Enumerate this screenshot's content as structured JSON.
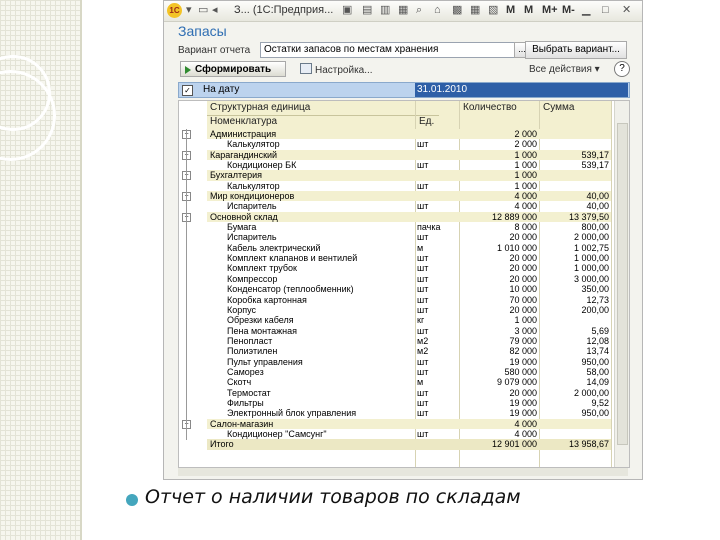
{
  "window": {
    "title": "З... (1С:Предприя...",
    "menu_letters": [
      "M",
      "M",
      "M+",
      "M-"
    ]
  },
  "report_title": "Запасы",
  "variant": {
    "label": "Вариант отчета",
    "value": "Остатки запасов по местам хранения",
    "dots": "...",
    "select_button": "Выбрать вариант..."
  },
  "toolbar": {
    "generate": "Сформировать",
    "settings": "Настройка...",
    "all_actions": "Все действия ▾",
    "help": "?"
  },
  "filter": {
    "label": "На дату",
    "value": "31.01.2010",
    "checked": "✓"
  },
  "table": {
    "headers": {
      "col1_top": "Структурная единица",
      "col1_bottom": "Номенклатура",
      "col2": "Ед.",
      "col3": "Количество",
      "col4": "Сумма"
    },
    "rows": [
      {
        "name": "Администрация",
        "unit": "",
        "qty": "2 000",
        "sum": "",
        "level": 0
      },
      {
        "name": "Калькулятор",
        "unit": "шт",
        "qty": "2 000",
        "sum": "",
        "level": 1
      },
      {
        "name": "Карагандинский",
        "unit": "",
        "qty": "1 000",
        "sum": "539,17",
        "level": 0
      },
      {
        "name": "Кондиционер БК",
        "unit": "шт",
        "qty": "1 000",
        "sum": "539,17",
        "level": 1
      },
      {
        "name": "Бухгалтерия",
        "unit": "",
        "qty": "1 000",
        "sum": "",
        "level": 0
      },
      {
        "name": "Калькулятор",
        "unit": "шт",
        "qty": "1 000",
        "sum": "",
        "level": 1
      },
      {
        "name": "Мир кондиционеров",
        "unit": "",
        "qty": "4 000",
        "sum": "40,00",
        "level": 0
      },
      {
        "name": "Испаритель",
        "unit": "шт",
        "qty": "4 000",
        "sum": "40,00",
        "level": 1
      },
      {
        "name": "Основной склад",
        "unit": "",
        "qty": "12 889 000",
        "sum": "13 379,50",
        "level": 0
      },
      {
        "name": "Бумага",
        "unit": "пачка",
        "qty": "8 000",
        "sum": "800,00",
        "level": 1
      },
      {
        "name": "Испаритель",
        "unit": "шт",
        "qty": "20 000",
        "sum": "2 000,00",
        "level": 1
      },
      {
        "name": "Кабель электрический",
        "unit": "м",
        "qty": "1 010 000",
        "sum": "1 002,75",
        "level": 1
      },
      {
        "name": "Комплект клапанов и вентилей",
        "unit": "шт",
        "qty": "20 000",
        "sum": "1 000,00",
        "level": 1
      },
      {
        "name": "Комплект трубок",
        "unit": "шт",
        "qty": "20 000",
        "sum": "1 000,00",
        "level": 1
      },
      {
        "name": "Компрессор",
        "unit": "шт",
        "qty": "20 000",
        "sum": "3 000,00",
        "level": 1
      },
      {
        "name": "Конденсатор (теплообменник)",
        "unit": "шт",
        "qty": "10 000",
        "sum": "350,00",
        "level": 1
      },
      {
        "name": "Коробка картонная",
        "unit": "шт",
        "qty": "70 000",
        "sum": "12,73",
        "level": 1
      },
      {
        "name": "Корпус",
        "unit": "шт",
        "qty": "20 000",
        "sum": "200,00",
        "level": 1
      },
      {
        "name": "Обрезки кабеля",
        "unit": "кг",
        "qty": "1 000",
        "sum": "",
        "level": 1
      },
      {
        "name": "Пена монтажная",
        "unit": "шт",
        "qty": "3 000",
        "sum": "5,69",
        "level": 1
      },
      {
        "name": "Пенопласт",
        "unit": "м2",
        "qty": "79 000",
        "sum": "12,08",
        "level": 1
      },
      {
        "name": "Полиэтилен",
        "unit": "м2",
        "qty": "82 000",
        "sum": "13,74",
        "level": 1
      },
      {
        "name": "Пульт управления",
        "unit": "шт",
        "qty": "19 000",
        "sum": "950,00",
        "level": 1
      },
      {
        "name": "Саморез",
        "unit": "шт",
        "qty": "580 000",
        "sum": "58,00",
        "level": 1
      },
      {
        "name": "Скотч",
        "unit": "м",
        "qty": "9 079 000",
        "sum": "14,09",
        "level": 1
      },
      {
        "name": "Термостат",
        "unit": "шт",
        "qty": "20 000",
        "sum": "2 000,00",
        "level": 1
      },
      {
        "name": "Фильтры",
        "unit": "шт",
        "qty": "19 000",
        "sum": "9,52",
        "level": 1
      },
      {
        "name": "Электронный блок управления",
        "unit": "шт",
        "qty": "19 000",
        "sum": "950,00",
        "level": 1
      },
      {
        "name": "Салон-магазин",
        "unit": "",
        "qty": "4 000",
        "sum": "",
        "level": 0
      },
      {
        "name": "Кондиционер \"Самсунг\"",
        "unit": "шт",
        "qty": "4 000",
        "sum": "",
        "level": 1
      },
      {
        "name": "Итого",
        "unit": "",
        "qty": "12 901 000",
        "sum": "13 958,67",
        "level": 2
      }
    ]
  },
  "caption": "Отчет о наличии товаров по складам",
  "colors": {
    "accent": "#2f6eb3",
    "header_bg": "#f3f0d0",
    "bullet": "#44a6bd",
    "selection": "#2e5fa7"
  }
}
